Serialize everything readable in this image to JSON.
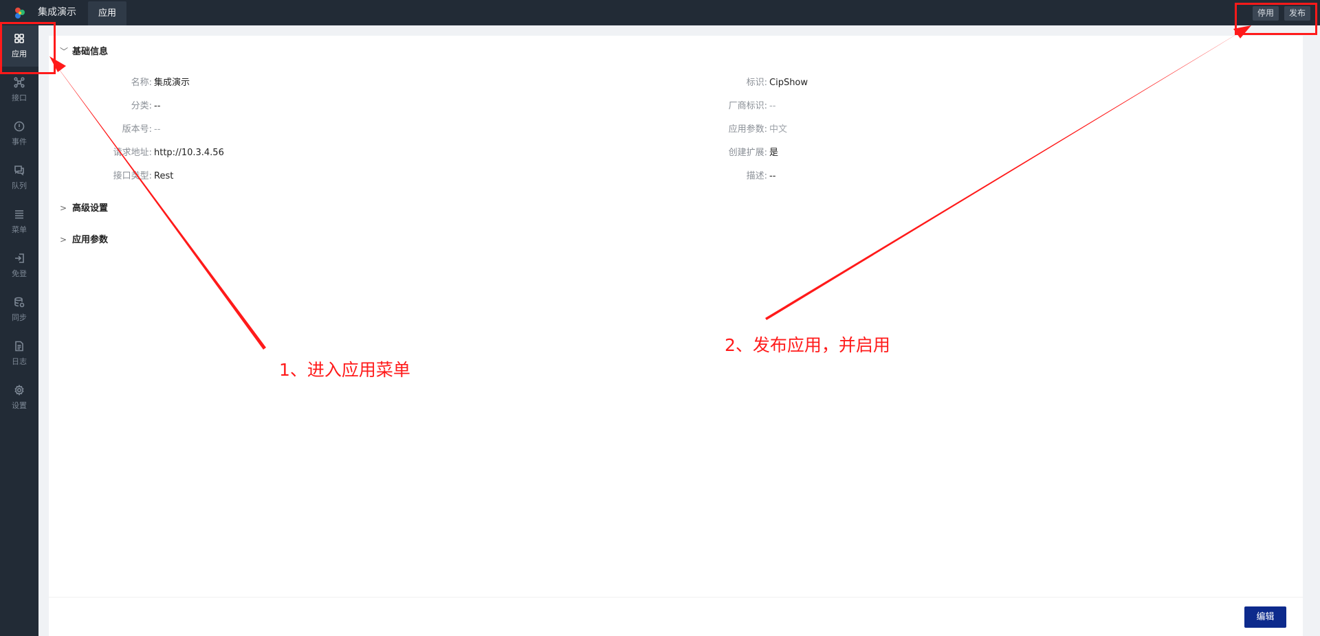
{
  "header": {
    "app_title": "集成演示",
    "tab_label": "应用",
    "disable_label": "停用",
    "publish_label": "发布"
  },
  "sidebar": {
    "items": [
      {
        "label": "应用",
        "icon": "grid-icon",
        "active": true
      },
      {
        "label": "接口",
        "icon": "api-nodes-icon"
      },
      {
        "label": "事件",
        "icon": "alert-circle-icon"
      },
      {
        "label": "队列",
        "icon": "message-queue-icon"
      },
      {
        "label": "菜单",
        "icon": "menu-list-icon"
      },
      {
        "label": "免登",
        "icon": "login-icon"
      },
      {
        "label": "同步",
        "icon": "database-sync-icon"
      },
      {
        "label": "日志",
        "icon": "file-log-icon"
      },
      {
        "label": "设置",
        "icon": "gear-icon"
      }
    ]
  },
  "basic_info": {
    "title": "基础信息",
    "left": [
      {
        "key": "名称:",
        "value": "集成演示"
      },
      {
        "key": "分类:",
        "value": "--"
      },
      {
        "key": "版本号:",
        "value": "--"
      },
      {
        "key": "请求地址:",
        "value": "http://10.3.4.56"
      },
      {
        "key": "接口类型:",
        "value": "Rest"
      }
    ],
    "right": [
      {
        "key": "标识:",
        "value": "CipShow"
      },
      {
        "key": "厂商标识:",
        "value": "--"
      },
      {
        "key": "应用参数:",
        "value": "中文"
      },
      {
        "key": "创建扩展:",
        "value": "是"
      },
      {
        "key": "描述:",
        "value": "--"
      }
    ]
  },
  "sections": {
    "advanced": "高级设置",
    "app_params": "应用参数"
  },
  "footer": {
    "edit_label": "编辑"
  },
  "annotations": {
    "step1": "1、进入应用菜单",
    "step2": "2、发布应用，并启用",
    "color": "#ff1a1a"
  },
  "colors": {
    "topbar": "#222b36",
    "primary_button": "#0d2a8c"
  }
}
